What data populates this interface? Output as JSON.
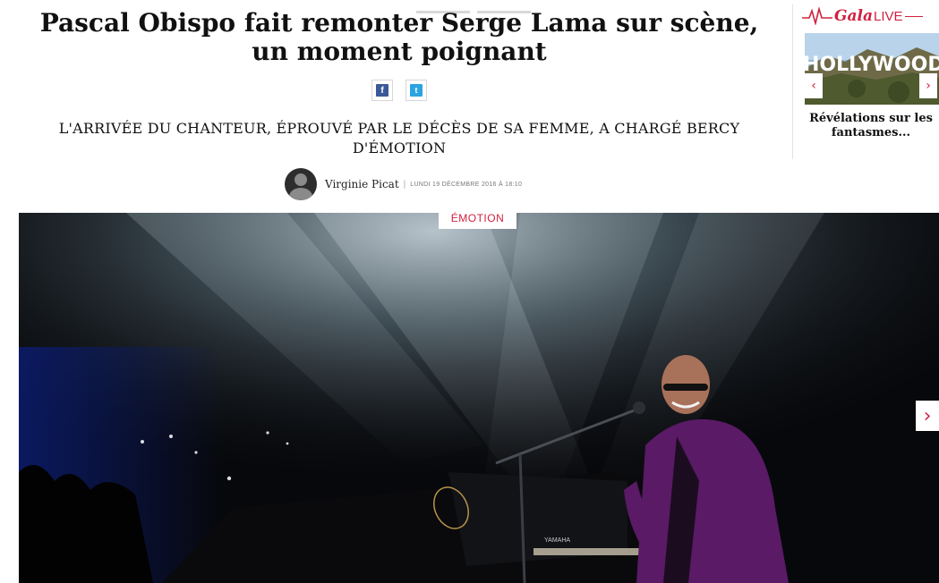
{
  "article": {
    "headline": "Pascal Obispo fait remonter Serge Lama sur scène, un moment poignant",
    "subtitle": "L'ARRIVÉE DU CHANTEUR, ÉPROUVÉ PAR LE DÉCÈS DE SA FEMME, A CHARGÉ BERCY D'ÉMOTION",
    "author": "Virginie Picat",
    "separator": "|",
    "date": "LUNDI 19 DÉCEMBRE 2016 À 18:10",
    "tag": "ÉMOTION"
  },
  "share": {
    "facebook_glyph": "f",
    "twitter_glyph": "t"
  },
  "hero": {
    "next_glyph": "›",
    "piano_brand": "YAMAHA"
  },
  "sidebar": {
    "brand": "Gala",
    "live": "LIVE",
    "thumb_sign": "HOLLYWOOD",
    "prev_glyph": "‹",
    "next_glyph": "›",
    "caption": "Révélations sur les fantasmes..."
  },
  "colors": {
    "accent": "#d1203f",
    "facebook": "#3b5998",
    "twitter": "#2aa4e0"
  },
  "icons": [
    "facebook-icon",
    "twitter-icon",
    "avatar",
    "chevron-right-icon",
    "chevron-left-icon",
    "pulse-icon"
  ]
}
